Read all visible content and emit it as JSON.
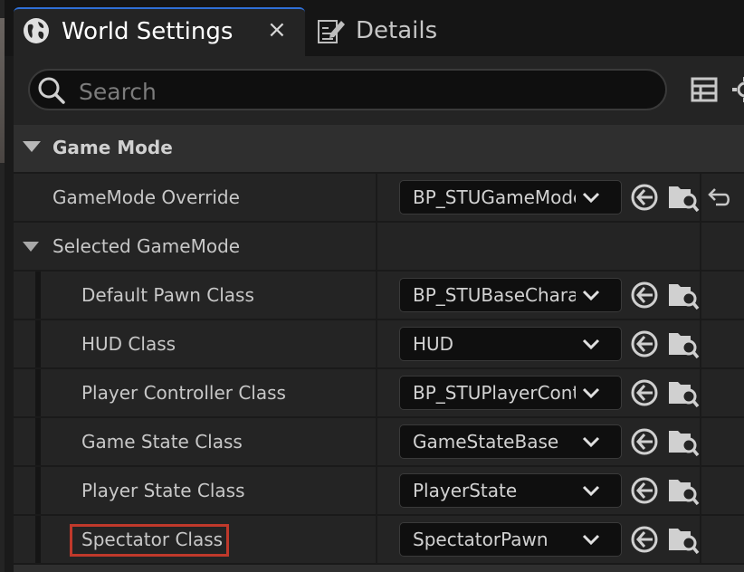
{
  "tabs": {
    "active": {
      "label": "World Settings",
      "close": "×"
    },
    "inactive": {
      "label": "Details"
    }
  },
  "search": {
    "placeholder": "Search",
    "value": ""
  },
  "category": {
    "label": "Game Mode"
  },
  "rows": [
    {
      "name": "GameMode Override",
      "value": "BP_STUGameMode"
    },
    {
      "name": "Selected GameMode"
    },
    {
      "name": "Default Pawn Class",
      "value": "BP_STUBaseCharacter"
    },
    {
      "name": "HUD Class",
      "value": "HUD"
    },
    {
      "name": "Player Controller Class",
      "value": "BP_STUPlayerController"
    },
    {
      "name": "Game State Class",
      "value": "GameStateBase"
    },
    {
      "name": "Player State Class",
      "value": "PlayerState"
    },
    {
      "name": "Spectator Class",
      "value": "SpectatorPawn"
    }
  ],
  "colors": {
    "accent": "#2f6fd6",
    "highlight": "#c0392b",
    "panel": "#242424",
    "field": "#0f0f0f"
  },
  "icons": {
    "tab_world": "globe-icon",
    "tab_details": "edit-icon",
    "search": "search-icon",
    "view_options": "table-icon",
    "settings": "gear-icon",
    "combo": "chevron-down-icon",
    "use_selected": "use-selected-icon",
    "browse": "browse-folder-icon",
    "reset": "reset-arrow-icon"
  }
}
